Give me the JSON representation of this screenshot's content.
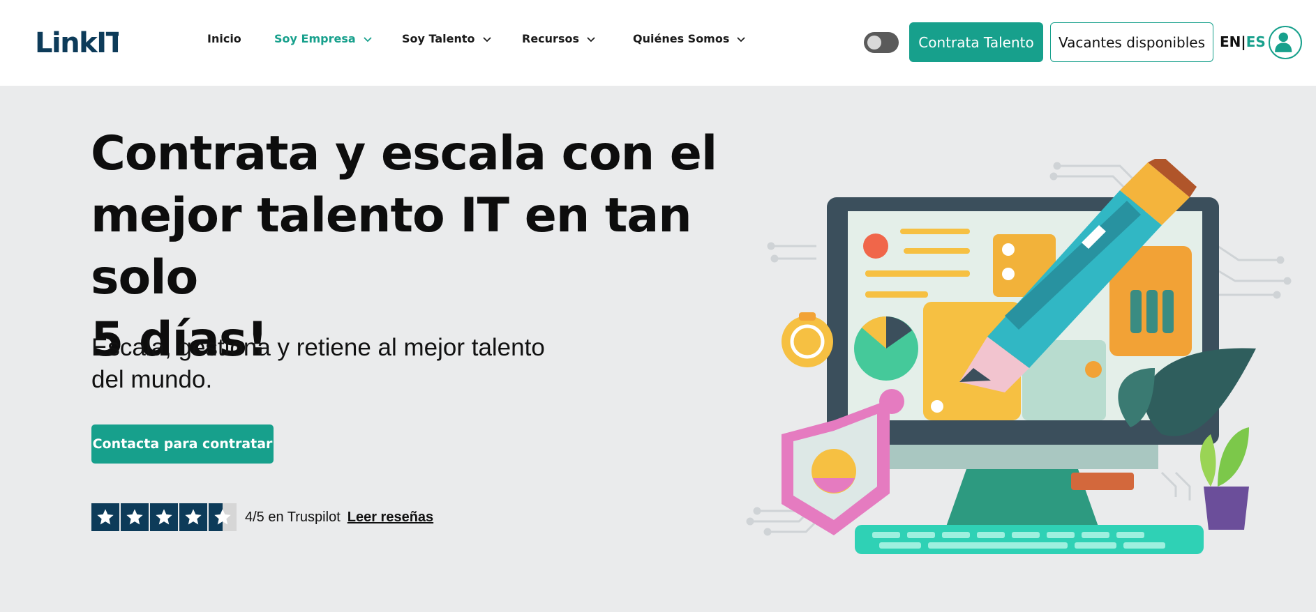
{
  "header": {
    "logo_text": "LinkIT",
    "nav": [
      {
        "label": "Inicio",
        "has_dropdown": false,
        "active": false
      },
      {
        "label": "Soy Empresa",
        "has_dropdown": true,
        "active": true
      },
      {
        "label": "Soy Talento",
        "has_dropdown": true,
        "active": false
      },
      {
        "label": "Recursos",
        "has_dropdown": true,
        "active": false
      },
      {
        "label": "Quiénes Somos",
        "has_dropdown": true,
        "active": false
      }
    ],
    "theme_toggle": {
      "state": "off"
    },
    "primary_button": "Contrata Talento",
    "secondary_button": "Vacantes disponibles",
    "lang": {
      "en": "EN",
      "separator": "|",
      "es": "ES",
      "active": "ES"
    },
    "user_icon": "user-icon"
  },
  "hero": {
    "title_lines": [
      "Contrata y escala con el",
      "mejor talento IT en tan solo",
      "5 días!"
    ],
    "subtitle_lines": [
      "Escala, gestiona y retiene al mejor talento",
      "del mundo."
    ],
    "cta": "Contacta para contratar",
    "rating": {
      "value": 4.5,
      "max": 5,
      "text": "4/5 en Truspilot",
      "link": "Leer reseñas"
    }
  },
  "colors": {
    "accent": "#17a08c",
    "background": "#eaebec",
    "header_bg": "#ffffff",
    "logo": "#0d3b59",
    "star_bg": "#0d3b59"
  }
}
